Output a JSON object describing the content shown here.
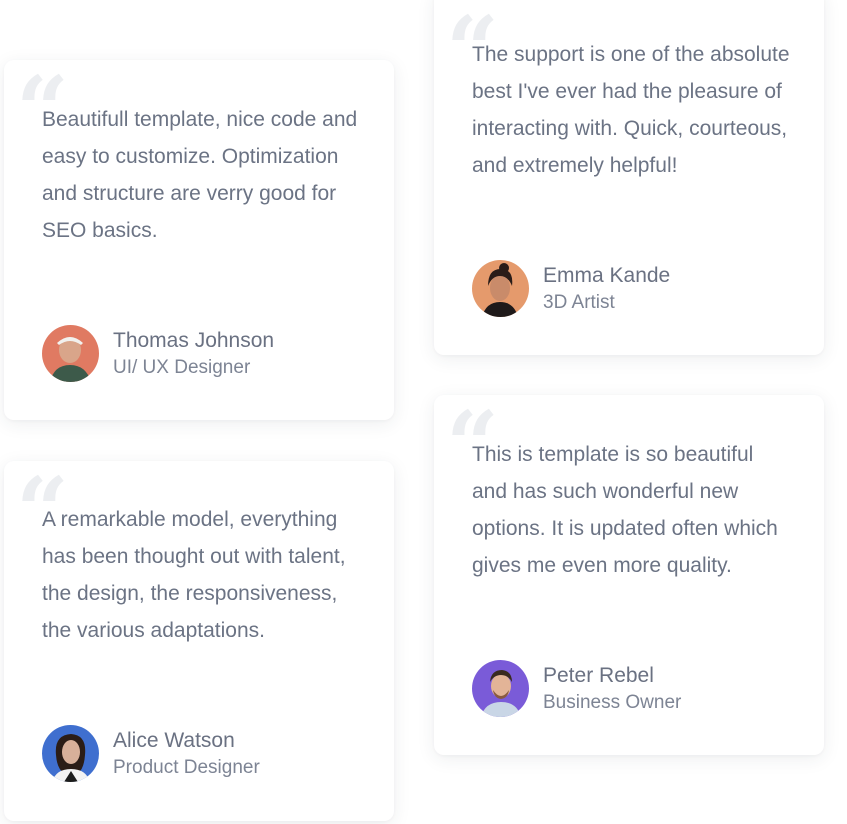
{
  "testimonials": [
    {
      "quote": "Beautifull template, nice code and easy to customize. Optimization and structure are verry good for SEO basics.",
      "name": "Thomas Johnson",
      "role": "UI/ UX Designer",
      "avatar_color": "#e07a62"
    },
    {
      "quote": "The support is one of the absolute best I've ever had the pleasure of interacting with. Quick, courteous, and extremely helpful!",
      "name": "Emma Kande",
      "role": "3D Artist",
      "avatar_color": "#e59a6c"
    },
    {
      "quote": "A remarkable model, everything has been thought out with talent, the design, the responsiveness, the various adaptations.",
      "name": "Alice Watson",
      "role": "Product Designer",
      "avatar_color": "#3f6fcf"
    },
    {
      "quote": "This is template is so beautiful and has such wonderful new options. It is updated often which gives me even more quality.",
      "name": "Peter Rebel",
      "role": "Business Owner",
      "avatar_color": "#7a5bd8"
    }
  ],
  "icons": {
    "quote": "quote-icon"
  },
  "colors": {
    "text": "#6b7384",
    "quote_mark": "#eceef1"
  }
}
